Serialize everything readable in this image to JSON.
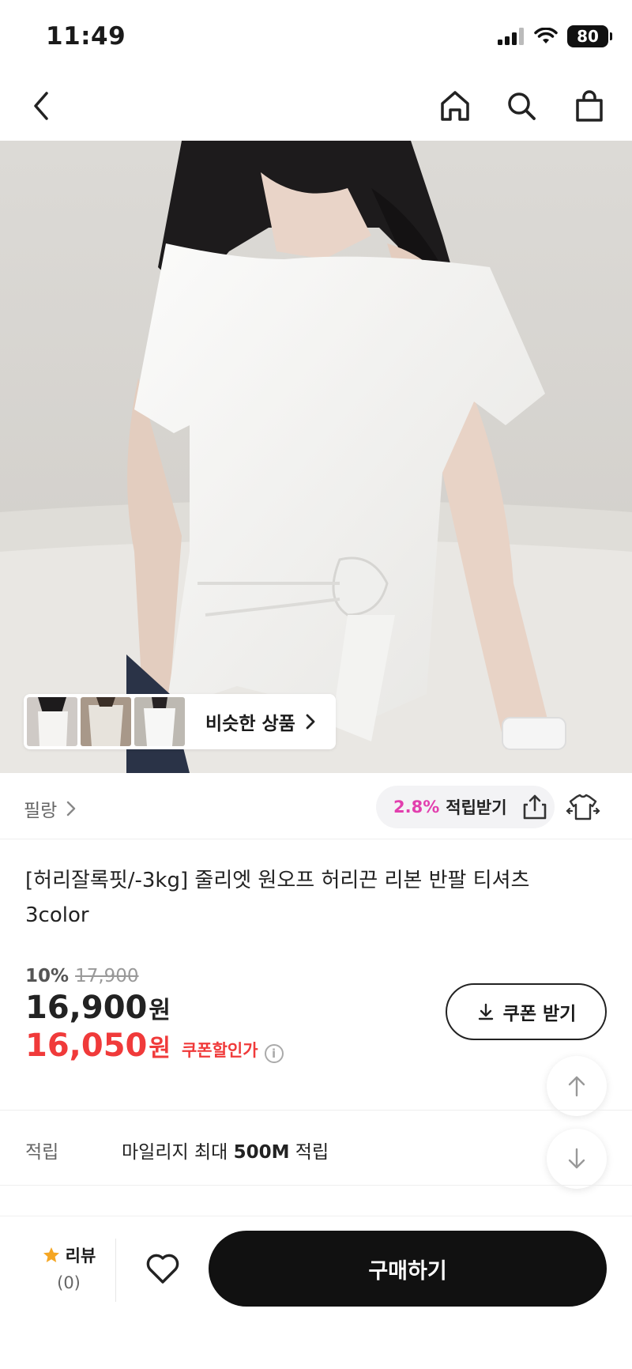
{
  "status_bar": {
    "time": "11:49",
    "battery": "80"
  },
  "nav": {
    "back_icon": "chevron-left-icon",
    "home_icon": "home-icon",
    "search_icon": "search-icon",
    "cart_icon": "shopping-bag-icon"
  },
  "similar": {
    "label": "비슷한 상품"
  },
  "brand": {
    "name": "필랑",
    "points_rate": "2.8%",
    "points_label": "적립받기"
  },
  "product": {
    "title": "[허리잘록핏/-3kg] 줄리엣 원오프 허리끈 리본 반팔 티셔츠 3color",
    "discount_pct": "10%",
    "original_price": "17,900",
    "price": "16,900",
    "price_unit": "원",
    "coupon_price": "16,050",
    "coupon_unit": "원",
    "coupon_label": "쿠폰할인가",
    "coupon_button": "쿠폰 받기"
  },
  "points_info": {
    "label": "적립",
    "text_prefix": "마일리지 최대 ",
    "text_bold": "500M",
    "text_suffix": " 적립"
  },
  "bottom_bar": {
    "review_label": "리뷰",
    "review_count": "(0)",
    "buy_label": "구매하기"
  },
  "colors": {
    "accent_pink": "#e23fae",
    "sale_red": "#f03a3a",
    "buy_button": "#111111"
  }
}
